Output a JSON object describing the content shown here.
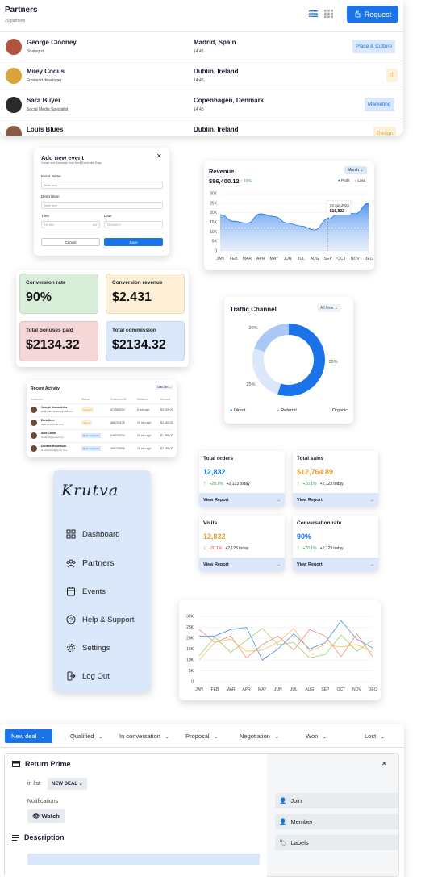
{
  "partners": {
    "title": "Partners",
    "count": "20 partners",
    "request_label": "Request",
    "rows": [
      {
        "name": "George Clooney",
        "role": "Strategist",
        "city": "Madrid, Spain",
        "time": "14:45",
        "tag": "Place & Culture",
        "tag_bg": "#dbe8fb",
        "tag_fg": "#1a73e8"
      },
      {
        "name": "Miley Codus",
        "role": "Frontend developer",
        "city": "Dublin, Ireland",
        "time": "14:45",
        "tag": "IT",
        "tag_bg": "#fdf1d8",
        "tag_fg": "#e8a33a"
      },
      {
        "name": "Sara Buyer",
        "role": "Social Media Specialist",
        "city": "Copenhagen, Denmark",
        "time": "14:45",
        "tag": "Marketing",
        "tag_bg": "#dbe8fb",
        "tag_fg": "#1a73e8"
      },
      {
        "name": "Louis Blues",
        "role": "",
        "city": "Dublin, Ireland",
        "time": "",
        "tag": "Design",
        "tag_bg": "#fdf1d8",
        "tag_fg": "#e8a33a"
      }
    ]
  },
  "event": {
    "title": "Add new event",
    "subtitle": "Create and Schedule Your Next Event with Ease",
    "name_label": "Event Name",
    "name_ph": "Write here",
    "desc_label": "Description",
    "desc_ph": "Write here",
    "time_label": "Time",
    "time_ph": "HH:MM",
    "time_suffix": "AM",
    "date_label": "Date",
    "date_ph": "DD/MM/YY",
    "cancel": "Cancel",
    "save": "Save"
  },
  "revenue": {
    "title": "Revenue",
    "period": "Month",
    "total": "$86,400.12",
    "change": "10%",
    "legend": [
      "Profit",
      "Loss"
    ],
    "tooltip_date": "03 Apr,2024",
    "tooltip_value": "$16,832"
  },
  "stats": [
    {
      "label": "Conversion rate",
      "value": "90%",
      "bg": "#d8eed9"
    },
    {
      "label": "Conversion revenue",
      "value": "$2.431",
      "bg": "#fdf0d6"
    },
    {
      "label": "Total bonuses paid",
      "value": "$2134.32",
      "bg": "#f6d7d8"
    },
    {
      "label": "Total commission",
      "value": "$2134.32",
      "bg": "#dbe8fb"
    }
  ],
  "traffic": {
    "title": "Traffic Channel",
    "period": "All time",
    "legend": [
      "Direct",
      "Referral",
      "Organic"
    ]
  },
  "recent": {
    "title": "Recent Activity",
    "period": "Last 24h",
    "headers": [
      "Customer",
      "Status",
      "Customer ID",
      "Retained",
      "Amount"
    ],
    "rows": [
      {
        "name": "Joseph Armandeka",
        "email": "joseph.armandeka@mail.com",
        "status": "Member",
        "sbg": "#fdf0d6",
        "sfg": "#e8a33a",
        "id": "#74563030",
        "ret": "5 min ago",
        "amt": "$3,509.00"
      },
      {
        "name": "Dark Kent",
        "email": "dark.kent@mail.com",
        "status": "Sign in",
        "sbg": "#fdf0d6",
        "sfg": "#e8a33a",
        "id": "#65236178",
        "ret": "10 min ago",
        "amt": "$2,652.00"
      },
      {
        "name": "Allie Crater",
        "email": "Crater.al@gmail.com",
        "status": "New Customer",
        "sbg": "#dbe8fb",
        "sfg": "#1a73e8",
        "id": "#45243234",
        "ret": "19 min ago",
        "amt": "$1,986.00"
      },
      {
        "name": "Darlene Robertson",
        "email": "D.robertson@gmail.com",
        "status": "New Customer",
        "sbg": "#dbe8fb",
        "sfg": "#1a73e8",
        "id": "#65234545",
        "ret": "15 min ago",
        "amt": "$2,056.00"
      }
    ]
  },
  "sidebar": {
    "logo": "Krutva",
    "items": [
      "Dashboard",
      "Partners",
      "Events",
      "Help & Support",
      "Settings",
      "Log Out"
    ]
  },
  "totals": [
    {
      "title": "Total orders",
      "value": "12,832",
      "color": "#1a73e8",
      "pct": "+20.1%",
      "dir": "up",
      "today": "+2,123 today",
      "link": "View Report"
    },
    {
      "title": "Total sales",
      "value": "$12,764.89",
      "color": "#e8a33a",
      "pct": "+20.1%",
      "dir": "up",
      "today": "+2,123 today",
      "link": "View Report"
    },
    {
      "title": "Visits",
      "value": "12,832",
      "color": "#e8a33a",
      "pct": "-20.1%",
      "dir": "down",
      "today": "+2,123 today",
      "link": "View Report"
    },
    {
      "title": "Conversation rate",
      "value": "90%",
      "color": "#1a73e8",
      "pct": "+20.1%",
      "dir": "up",
      "today": "+2,123 today",
      "link": "View Report"
    }
  ],
  "chart_data": [
    {
      "type": "area",
      "title": "Revenue",
      "categories": [
        "JAN",
        "FEB",
        "MAR",
        "APR",
        "MAY",
        "JUN",
        "JUL",
        "AUG",
        "SEP",
        "OCT",
        "NOV",
        "DEC"
      ],
      "yticks": [
        "30K",
        "25K",
        "20K",
        "15K",
        "10K",
        "5K",
        "0"
      ],
      "ylim": [
        0,
        30000
      ],
      "series": [
        {
          "name": "Profit",
          "values": [
            19000,
            15500,
            14500,
            19500,
            18000,
            14500,
            13000,
            11000,
            16800,
            21000,
            19500,
            25000
          ]
        }
      ]
    },
    {
      "type": "pie",
      "title": "Traffic Channel",
      "slices": [
        {
          "name": "Direct",
          "value": 55
        },
        {
          "name": "Referral",
          "value": 20
        },
        {
          "name": "Organic",
          "value": 25
        }
      ]
    },
    {
      "type": "line",
      "categories": [
        "JAN",
        "FEB",
        "MAR",
        "APR",
        "MAY",
        "JUN",
        "JUL",
        "AUG",
        "SEP",
        "OCT",
        "NOV",
        "DEC"
      ],
      "yticks": [
        "30K",
        "25K",
        "20K",
        "15K",
        "10K",
        "5K",
        "0"
      ],
      "ylim": [
        0,
        30000
      ],
      "series": [
        {
          "color": "#4a90e2",
          "values": [
            21000,
            21000,
            24000,
            25000,
            10000,
            15000,
            22000,
            15000,
            18000,
            28000,
            19500,
            15500
          ]
        },
        {
          "color": "#f08a7a",
          "values": [
            24000,
            18000,
            21000,
            11000,
            17000,
            21000,
            14500,
            24000,
            21000,
            11500,
            22000,
            11500
          ]
        },
        {
          "color": "#9dcf6e",
          "values": [
            12000,
            20500,
            13500,
            19000,
            24500,
            17000,
            18000,
            11000,
            12500,
            21500,
            14000,
            19000
          ]
        },
        {
          "color": "#f4c05a",
          "values": [
            10000,
            18000,
            19500,
            14000,
            14500,
            18000,
            24500,
            14000,
            17000,
            16000,
            17000,
            13500
          ]
        }
      ]
    }
  ],
  "deals": {
    "stages": [
      "New deal",
      "Qualified",
      "In conversation",
      "Proposal",
      "Negotiation",
      "Won",
      "Lost"
    ],
    "title": "Return Prime",
    "in_list": "in list",
    "list_value": "NEW DEAL",
    "notifications": "Notifications",
    "watch": "Watch",
    "description": "Description",
    "side": [
      "Join",
      "Member",
      "Labels"
    ]
  }
}
